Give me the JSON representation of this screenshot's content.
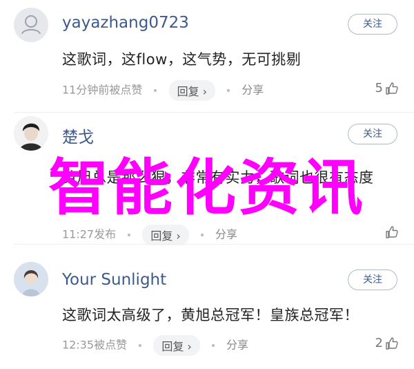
{
  "follow_label": "关注",
  "reply_label": "回复",
  "share_label": "分享",
  "watermark": "智能化资讯",
  "comments": [
    {
      "username": "yayazhang0723",
      "text": "这歌词，这flow，这气势，无可挑剔",
      "time": "11分钟前被点赞",
      "likes": "5"
    },
    {
      "username": "楚戈",
      "text": "黄旭总是那么狠，非常有实力，歌词也很有态度",
      "time": "11:27发布",
      "likes": ""
    },
    {
      "username": "Your Sunlight",
      "text": "这歌词太高级了，黄旭总冠军！皇族总冠军！",
      "time": "12:35被点赞",
      "likes": "2"
    }
  ]
}
